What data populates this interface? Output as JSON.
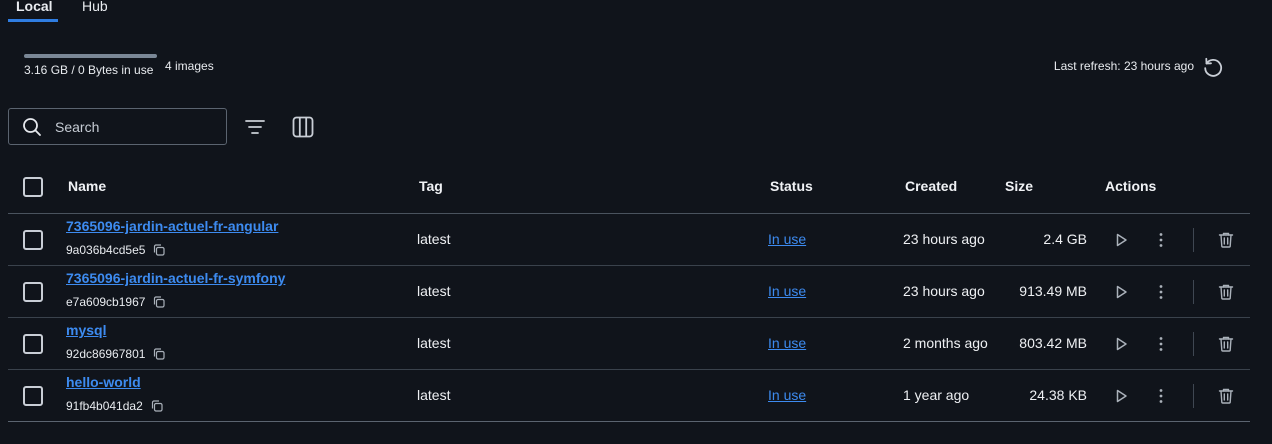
{
  "tabs": [
    {
      "label": "Local",
      "active": true
    },
    {
      "label": "Hub",
      "active": false
    }
  ],
  "usage": {
    "text": "3.16 GB / 0 Bytes in use",
    "images_count": "4 images",
    "fill_fraction": 1.0
  },
  "refresh": {
    "text": "Last refresh: 23 hours ago",
    "icon": "refresh-icon"
  },
  "search": {
    "placeholder": "Search",
    "value": ""
  },
  "toolbar": {
    "filter_icon": "filter-icon",
    "columns_icon": "columns-icon"
  },
  "table": {
    "headers": {
      "name": "Name",
      "tag": "Tag",
      "status": "Status",
      "created": "Created",
      "size": "Size",
      "actions": "Actions"
    },
    "rows": [
      {
        "name": "7365096-jardin-actuel-fr-angular",
        "id": "9a036b4cd5e5",
        "tag": "latest",
        "status": "In use",
        "created": "23 hours ago",
        "size": "2.4 GB"
      },
      {
        "name": "7365096-jardin-actuel-fr-symfony",
        "id": "e7a609cb1967",
        "tag": "latest",
        "status": "In use",
        "created": "23 hours ago",
        "size": "913.49 MB"
      },
      {
        "name": "mysql",
        "id": "92dc86967801",
        "tag": "latest",
        "status": "In use",
        "created": "2 months ago",
        "size": "803.42 MB"
      },
      {
        "name": "hello-world",
        "id": "91fb4b041da2",
        "tag": "latest",
        "status": "In use",
        "created": "1 year ago",
        "size": "24.38 KB"
      }
    ]
  },
  "colors": {
    "background": "#10141b",
    "accent": "#2f7de1",
    "link": "#3d8bf0"
  }
}
